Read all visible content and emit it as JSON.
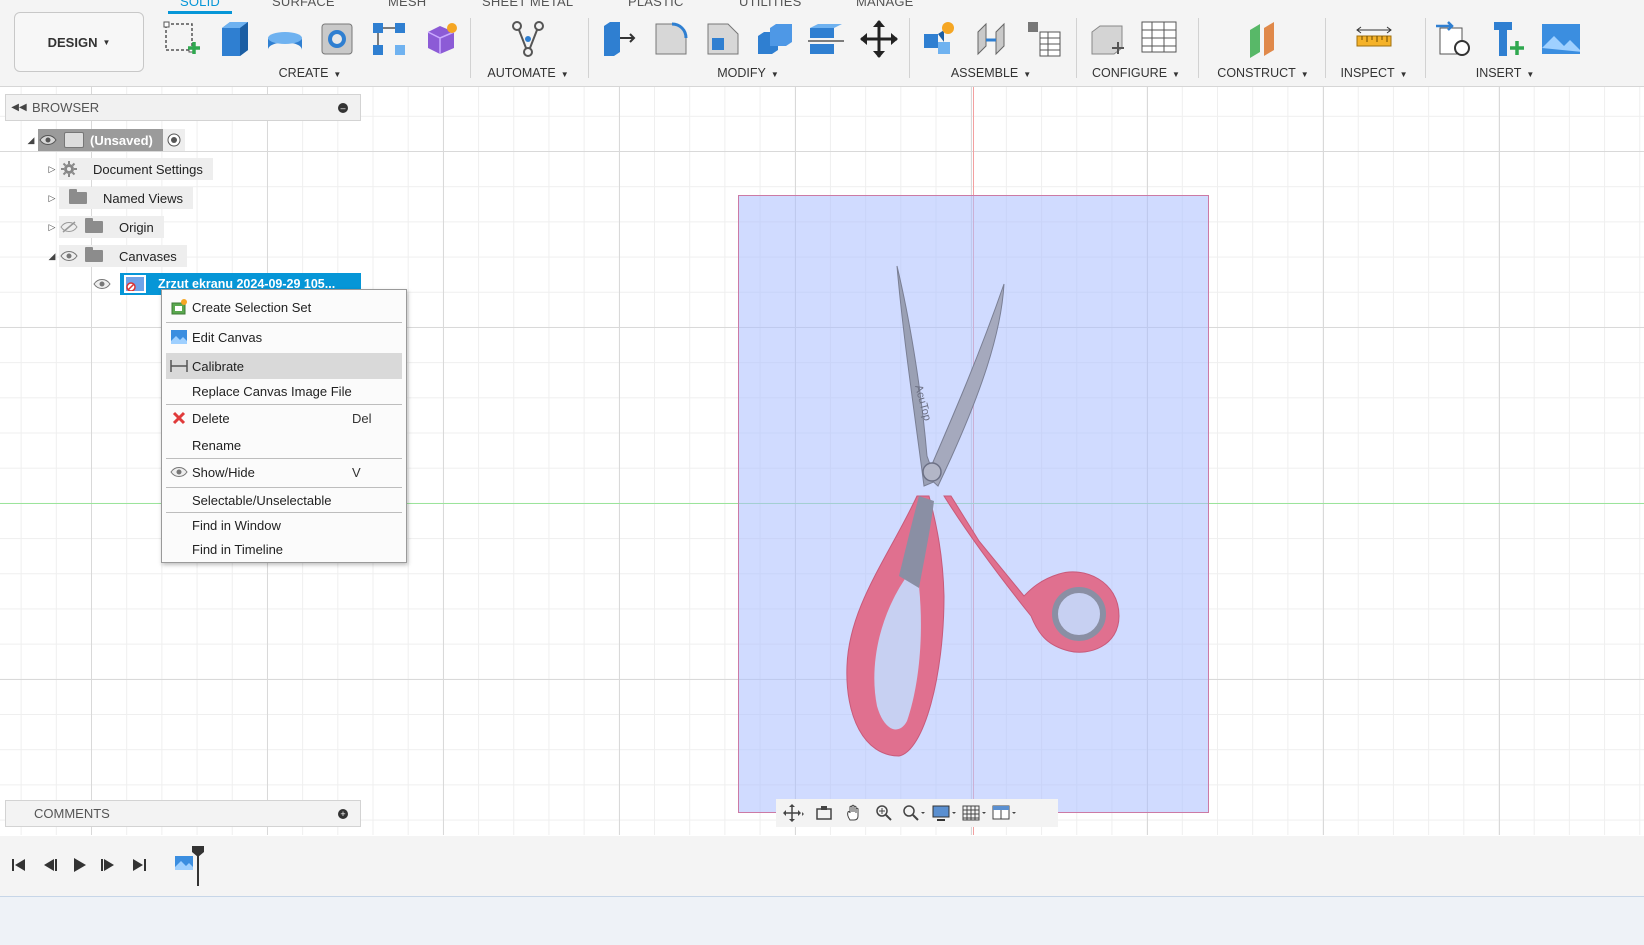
{
  "toolbar": {
    "tabs": [
      "SOLID",
      "SURFACE",
      "MESH",
      "SHEET METAL",
      "PLASTIC",
      "UTILITIES",
      "MANAGE"
    ],
    "design_label": "DESIGN",
    "groups": {
      "create": "CREATE",
      "automate": "AUTOMATE",
      "modify": "MODIFY",
      "assemble": "ASSEMBLE",
      "configure": "CONFIGURE",
      "construct": "CONSTRUCT",
      "inspect": "INSPECT",
      "insert": "INSERT"
    },
    "accent_color": "#0696d7"
  },
  "browser": {
    "title": "BROWSER",
    "root": "(Unsaved)",
    "items": [
      {
        "label": "Document Settings"
      },
      {
        "label": "Named Views"
      },
      {
        "label": "Origin"
      },
      {
        "label": "Canvases"
      }
    ],
    "selected_canvas": "Zrzut ekranu 2024-09-29 105..."
  },
  "context_menu": {
    "items": [
      {
        "label": "Create Selection Set",
        "shortcut": ""
      },
      {
        "label": "Edit Canvas",
        "shortcut": ""
      },
      {
        "label": "Calibrate",
        "shortcut": ""
      },
      {
        "label": "Replace Canvas Image File",
        "shortcut": ""
      },
      {
        "label": "Delete",
        "shortcut": "Del"
      },
      {
        "label": "Rename",
        "shortcut": ""
      },
      {
        "label": "Show/Hide",
        "shortcut": "V"
      },
      {
        "label": "Selectable/Unselectable",
        "shortcut": ""
      },
      {
        "label": "Find in Window",
        "shortcut": ""
      },
      {
        "label": "Find in Timeline",
        "shortcut": ""
      }
    ]
  },
  "comments": {
    "title": "COMMENTS"
  },
  "canvas_image": {
    "brand_text": "AcuTop"
  }
}
